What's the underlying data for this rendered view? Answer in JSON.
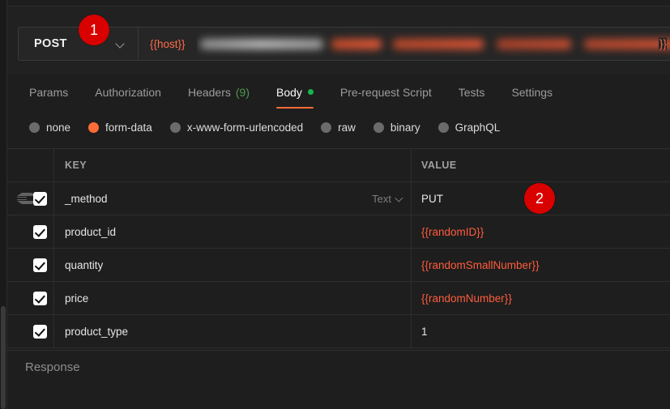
{
  "window": {
    "background": "#1e1e1e",
    "accent_orange": "#ff6c37",
    "accent_green": "#16b74f",
    "badge_red": "#d90000",
    "variable_color": "#ff5c3d"
  },
  "top_strip": {
    "ghost_fragment_1": "",
    "ghost_fragment_2": "",
    "ghost_fragment_3": ""
  },
  "request_bar": {
    "method": "POST",
    "method_chevron": "chevron-down-icon",
    "url_prefix": "{{host}}",
    "url_redacted": true,
    "url_suffix": "}}",
    "url_placeholder": "Enter request URL"
  },
  "request_tabs": [
    {
      "label": "Params",
      "active": false,
      "count": ""
    },
    {
      "label": "Authorization",
      "active": false,
      "count": ""
    },
    {
      "label": "Headers",
      "active": false,
      "count": "(9)"
    },
    {
      "label": "Body",
      "active": true,
      "count": "",
      "dot": true
    },
    {
      "label": "Pre-request Script",
      "active": false,
      "count": ""
    },
    {
      "label": "Tests",
      "active": false,
      "count": ""
    },
    {
      "label": "Settings",
      "active": false,
      "count": ""
    }
  ],
  "body_types": [
    {
      "label": "none",
      "selected": false
    },
    {
      "label": "form-data",
      "selected": true
    },
    {
      "label": "x-www-form-urlencoded",
      "selected": false
    },
    {
      "label": "raw",
      "selected": false
    },
    {
      "label": "binary",
      "selected": false
    },
    {
      "label": "GraphQL",
      "selected": false
    }
  ],
  "table": {
    "headers": {
      "key": "KEY",
      "value": "VALUE"
    },
    "rows": [
      {
        "checked": true,
        "key": "_method",
        "type_label": "Text",
        "value": "PUT",
        "value_is_variable": false,
        "has_drag_handle": true
      },
      {
        "checked": true,
        "key": "product_id",
        "type_label": "",
        "value": "{{randomID}}",
        "value_is_variable": true,
        "has_drag_handle": false
      },
      {
        "checked": true,
        "key": "quantity",
        "type_label": "",
        "value": "{{randomSmallNumber}}",
        "value_is_variable": true,
        "has_drag_handle": false
      },
      {
        "checked": true,
        "key": "price",
        "type_label": "",
        "value": "{{randomNumber}}",
        "value_is_variable": true,
        "has_drag_handle": false
      },
      {
        "checked": true,
        "key": "product_type",
        "type_label": "",
        "value": "1",
        "value_is_variable": false,
        "has_drag_handle": false
      }
    ]
  },
  "response": {
    "title": "Response"
  },
  "annotations": [
    {
      "label": "1"
    },
    {
      "label": "2"
    }
  ]
}
